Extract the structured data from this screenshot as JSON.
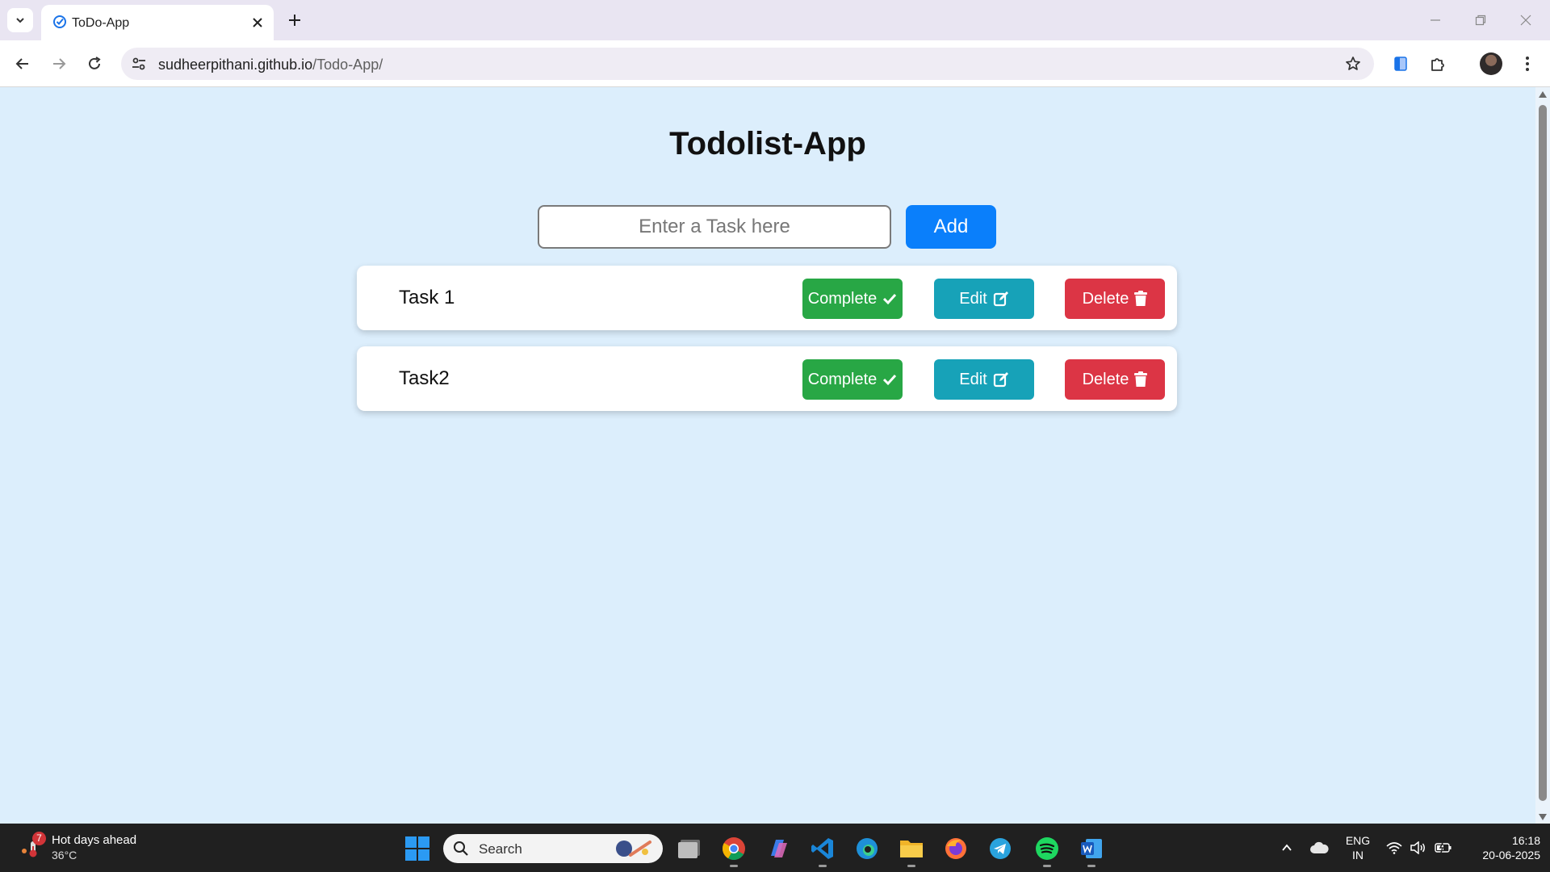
{
  "browser": {
    "tab_title": "ToDo-App",
    "url_host": "sudheerpithani.github.io",
    "url_path": "/Todo-App/"
  },
  "app": {
    "title": "Todolist-App",
    "input_placeholder": "Enter a Task here",
    "input_value": "",
    "add_label": "Add",
    "tasks": [
      {
        "text": "Task 1",
        "complete_label": "Complete",
        "edit_label": "Edit",
        "delete_label": "Delete"
      },
      {
        "text": "Task2",
        "complete_label": "Complete",
        "edit_label": "Edit",
        "delete_label": "Delete"
      }
    ],
    "colors": {
      "background": "#dceefc",
      "add": "#0a7ffb",
      "complete": "#28a745",
      "edit": "#17a2b8",
      "delete": "#dc3545"
    }
  },
  "taskbar": {
    "weather_title": "Hot days ahead",
    "weather_temp": "36°C",
    "weather_badge": "7",
    "search_label": "Search",
    "lang_line1": "ENG",
    "lang_line2": "IN",
    "time": "16:18",
    "date": "20-06-2025",
    "apps": [
      "file-explorer-icon",
      "chrome-icon",
      "copilot-icon",
      "vscode-icon",
      "edge-icon",
      "folder-icon",
      "firefox-icon",
      "telegram-icon",
      "spotify-icon",
      "word-icon"
    ]
  }
}
